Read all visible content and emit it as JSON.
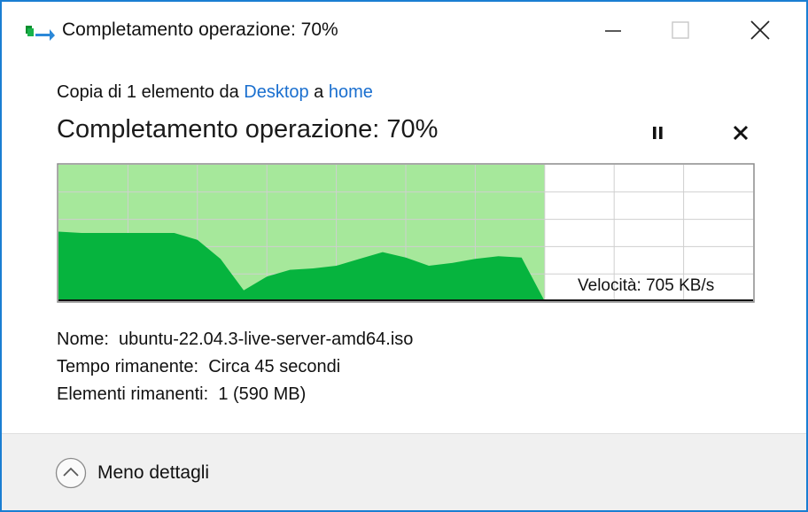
{
  "window": {
    "title": "Completamento operazione: 70%",
    "controls": {
      "minimize_icon": "minimize-icon",
      "maximize_icon": "maximize-icon",
      "close_icon": "close-icon"
    }
  },
  "copy_info": {
    "prefix": "Copia di 1 elemento da ",
    "source": "Desktop",
    "middle": " a ",
    "destination": "home"
  },
  "status": {
    "heading": "Completamento operazione: 70%",
    "progress_percent": 70,
    "pause_icon": "pause-icon",
    "cancel_icon": "cancel-icon"
  },
  "graph": {
    "speed_label": "Velocità: 705 KB/s",
    "speed_history_fraction_of_max": [
      0.51,
      0.5,
      0.5,
      0.5,
      0.5,
      0.5,
      0.45,
      0.31,
      0.08,
      0.18,
      0.23,
      0.24,
      0.26,
      0.31,
      0.36,
      0.32,
      0.26,
      0.28,
      0.31,
      0.33,
      0.32,
      0.0
    ],
    "colors": {
      "filled": "#a6e89b",
      "area": "#06b43e",
      "grid": "#cfcfcf",
      "border": "#8c8c8c"
    }
  },
  "details": {
    "name_label": "Nome:",
    "name_value": "ubuntu-22.04.3-live-server-amd64.iso",
    "time_label": "Tempo rimanente:",
    "time_value": "Circa 45 secondi",
    "items_label": "Elementi rimanenti:",
    "items_value": "1 (590 MB)"
  },
  "footer": {
    "toggle_label": "Meno dettagli",
    "toggle_icon": "chevron-up-icon"
  },
  "colors": {
    "window_border": "#1a7ed2",
    "link": "#1a6fcf",
    "footer_bg": "#f0f0f0"
  }
}
